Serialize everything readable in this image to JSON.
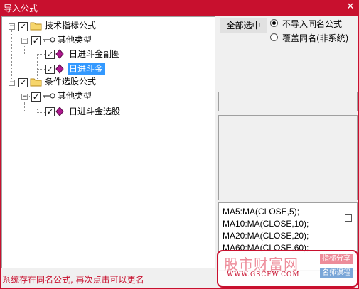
{
  "window": {
    "title": "导入公式",
    "close_glyph": "✕"
  },
  "tree": [
    {
      "label": "技术指标公式",
      "level": 0,
      "type": "folder",
      "checked": true,
      "expanded": true
    },
    {
      "label": "其他类型",
      "level": 1,
      "type": "key",
      "checked": true,
      "expanded": true
    },
    {
      "label": "日进斗金副图",
      "level": 2,
      "type": "diamond",
      "checked": true,
      "selected": false
    },
    {
      "label": "日进斗金",
      "level": 2,
      "type": "diamond",
      "checked": true,
      "selected": true
    },
    {
      "label": "条件选股公式",
      "level": 0,
      "type": "folder",
      "checked": true,
      "expanded": true
    },
    {
      "label": "其他类型",
      "level": 1,
      "type": "key",
      "checked": true,
      "expanded": true
    },
    {
      "label": "日进斗金选股",
      "level": 2,
      "type": "diamond",
      "checked": true,
      "selected": false
    }
  ],
  "right": {
    "select_all": "全部选中",
    "options": [
      {
        "label": "不导入同名公式",
        "selected": true
      },
      {
        "label": "覆盖同名(非系统)",
        "selected": false
      }
    ],
    "code": [
      "MA5:MA(CLOSE,5);",
      "MA10:MA(CLOSE,10);",
      "MA20:MA(CLOSE,20);",
      "MA60:MA(CLOSE,60);"
    ]
  },
  "status": "系统存在同名公式, 再次点击可以更名",
  "watermark": {
    "brand": "股市财富网",
    "url": "WWW.GSCFW.COM",
    "tag1": "指标分享",
    "tag2": "名师课程"
  },
  "colors": {
    "title_bar": "#c8102e",
    "selection": "#3399ff",
    "status_text": "#c8102e"
  }
}
